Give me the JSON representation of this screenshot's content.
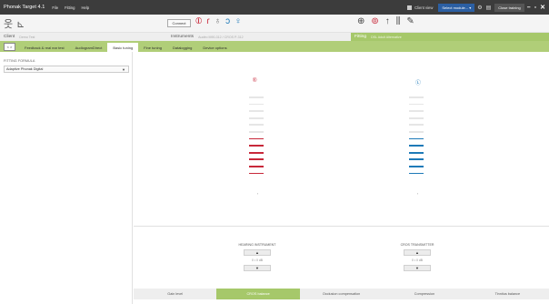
{
  "title_bar": {
    "app_title": "Phonak Target 4.1",
    "menus": [
      "File",
      "Fitting",
      "Help"
    ],
    "client_view_label": "Client view",
    "select_module_label": "Select module...",
    "close_training_label": "Close training"
  },
  "toolbar": {
    "connect_label": "Connect"
  },
  "section_bar": {
    "client_label": "Client",
    "client_name": "Demo Test",
    "instruments_label": "Instruments",
    "instruments_detail": "Audéo M90-312 / CROS P-312",
    "fitting_label": "Fitting",
    "fitting_detail": "DSL Adult Alternative"
  },
  "tabs": {
    "nav_arrows": "< >",
    "items": [
      "Feedback & real ear test",
      "AudiogramDirect",
      "Basic tuning",
      "Fine tuning",
      "Datalogging",
      "Device options"
    ],
    "active": "Basic tuning"
  },
  "left_panel": {
    "formula_label": "FITTING FORMULA",
    "formula_value": "Adaptive Phonak Digital"
  },
  "main": {
    "right_ear_label": "R",
    "left_ear_label": "L",
    "right_level": 6,
    "left_level": 6,
    "total_steps": 12
  },
  "controls": {
    "hearing_instrument_label": "HEARING INSTRUMENT",
    "hearing_instrument_value": "0 • 0 dB",
    "cros_transmitter_label": "CROS TRANSMITTER",
    "cros_transmitter_value": "0 • 0 dB",
    "up_glyph": "▲",
    "down_glyph": "▼"
  },
  "bottom_tabs": {
    "items": [
      "Gain level",
      "CROS balance",
      "Occlusion compensation",
      "Compression",
      "Tinnitus balance"
    ],
    "active": "CROS balance"
  },
  "colors": {
    "accent_green": "#a6c86a",
    "tab_green": "#b0ce78",
    "right_red": "#c8283a",
    "left_blue": "#1e7ab8",
    "titlebar_dark": "#3c3c3c"
  }
}
